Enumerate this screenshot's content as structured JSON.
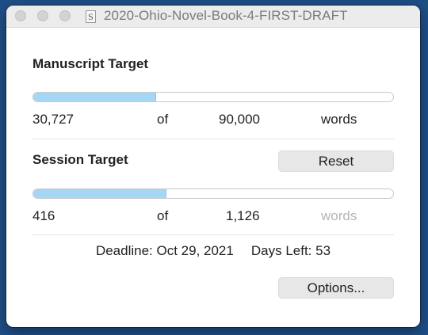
{
  "window": {
    "title": "2020-Ohio-Novel-Book-4-FIRST-DRAFT"
  },
  "manuscript": {
    "heading": "Manuscript Target",
    "current": "30,727",
    "of_label": "of",
    "target": "90,000",
    "unit": "words",
    "progress_fraction": 0.341
  },
  "session": {
    "heading": "Session Target",
    "reset_label": "Reset",
    "current": "416",
    "of_label": "of",
    "target": "1,126",
    "unit": "words",
    "progress_fraction": 0.369
  },
  "deadline": {
    "label": "Deadline: Oct 29, 2021",
    "days_left": "Days Left: 53"
  },
  "options_label": "Options...",
  "colors": {
    "progress_fill": "#a6d6f5",
    "desktop_background": "#1f4f87"
  },
  "icons": {
    "document": "scrivener-document-icon"
  }
}
